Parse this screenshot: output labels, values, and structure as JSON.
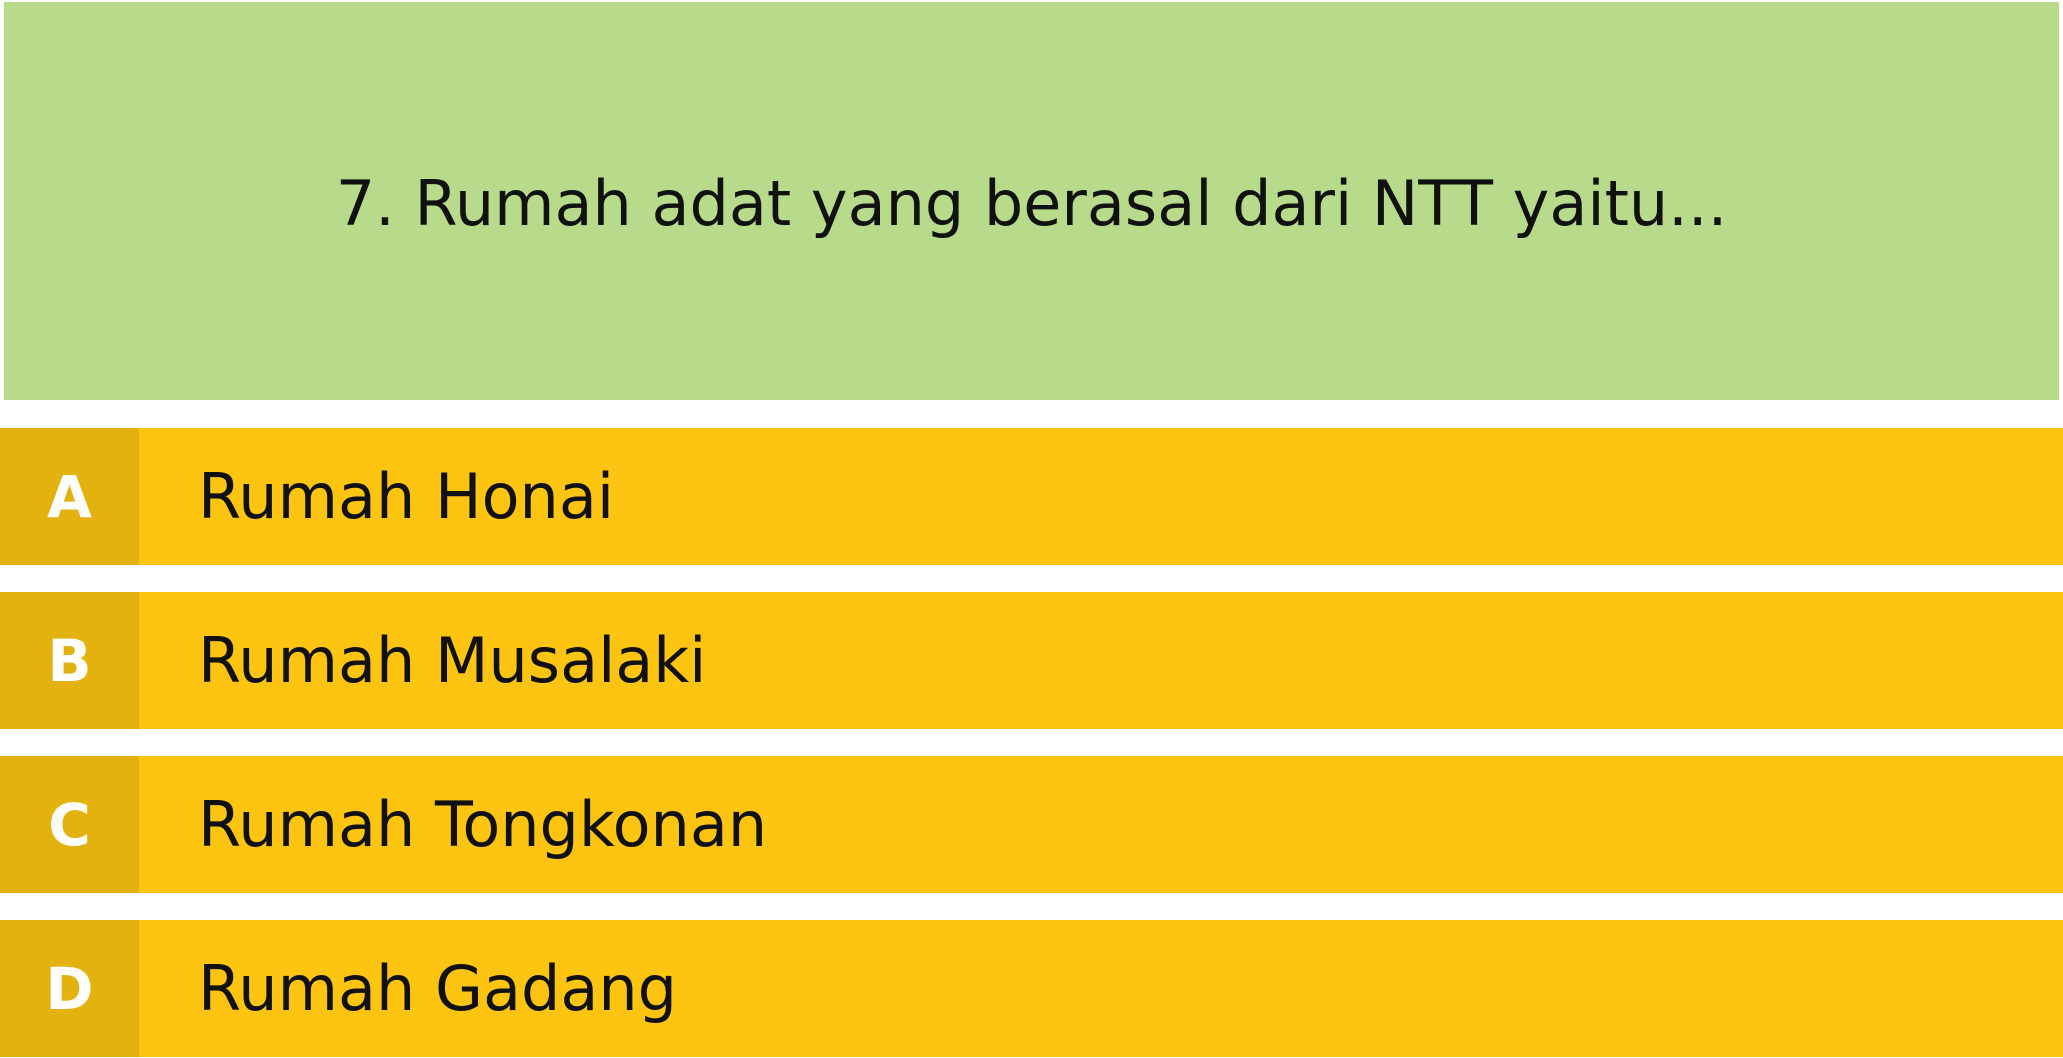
{
  "question": {
    "text": "7. Rumah adat yang berasal dari NTT yaitu..."
  },
  "options": [
    {
      "letter": "A",
      "text": "Rumah Honai"
    },
    {
      "letter": "B",
      "text": "Rumah Musalaki"
    },
    {
      "letter": "C",
      "text": "Rumah Tongkonan"
    },
    {
      "letter": "D",
      "text": "Rumah Gadang"
    }
  ],
  "colors": {
    "question_background": "#b7db8a",
    "option_background": "#fdc511",
    "letter_background": "#e4b20e",
    "letter_text": "#ffffff",
    "text": "#111111"
  }
}
